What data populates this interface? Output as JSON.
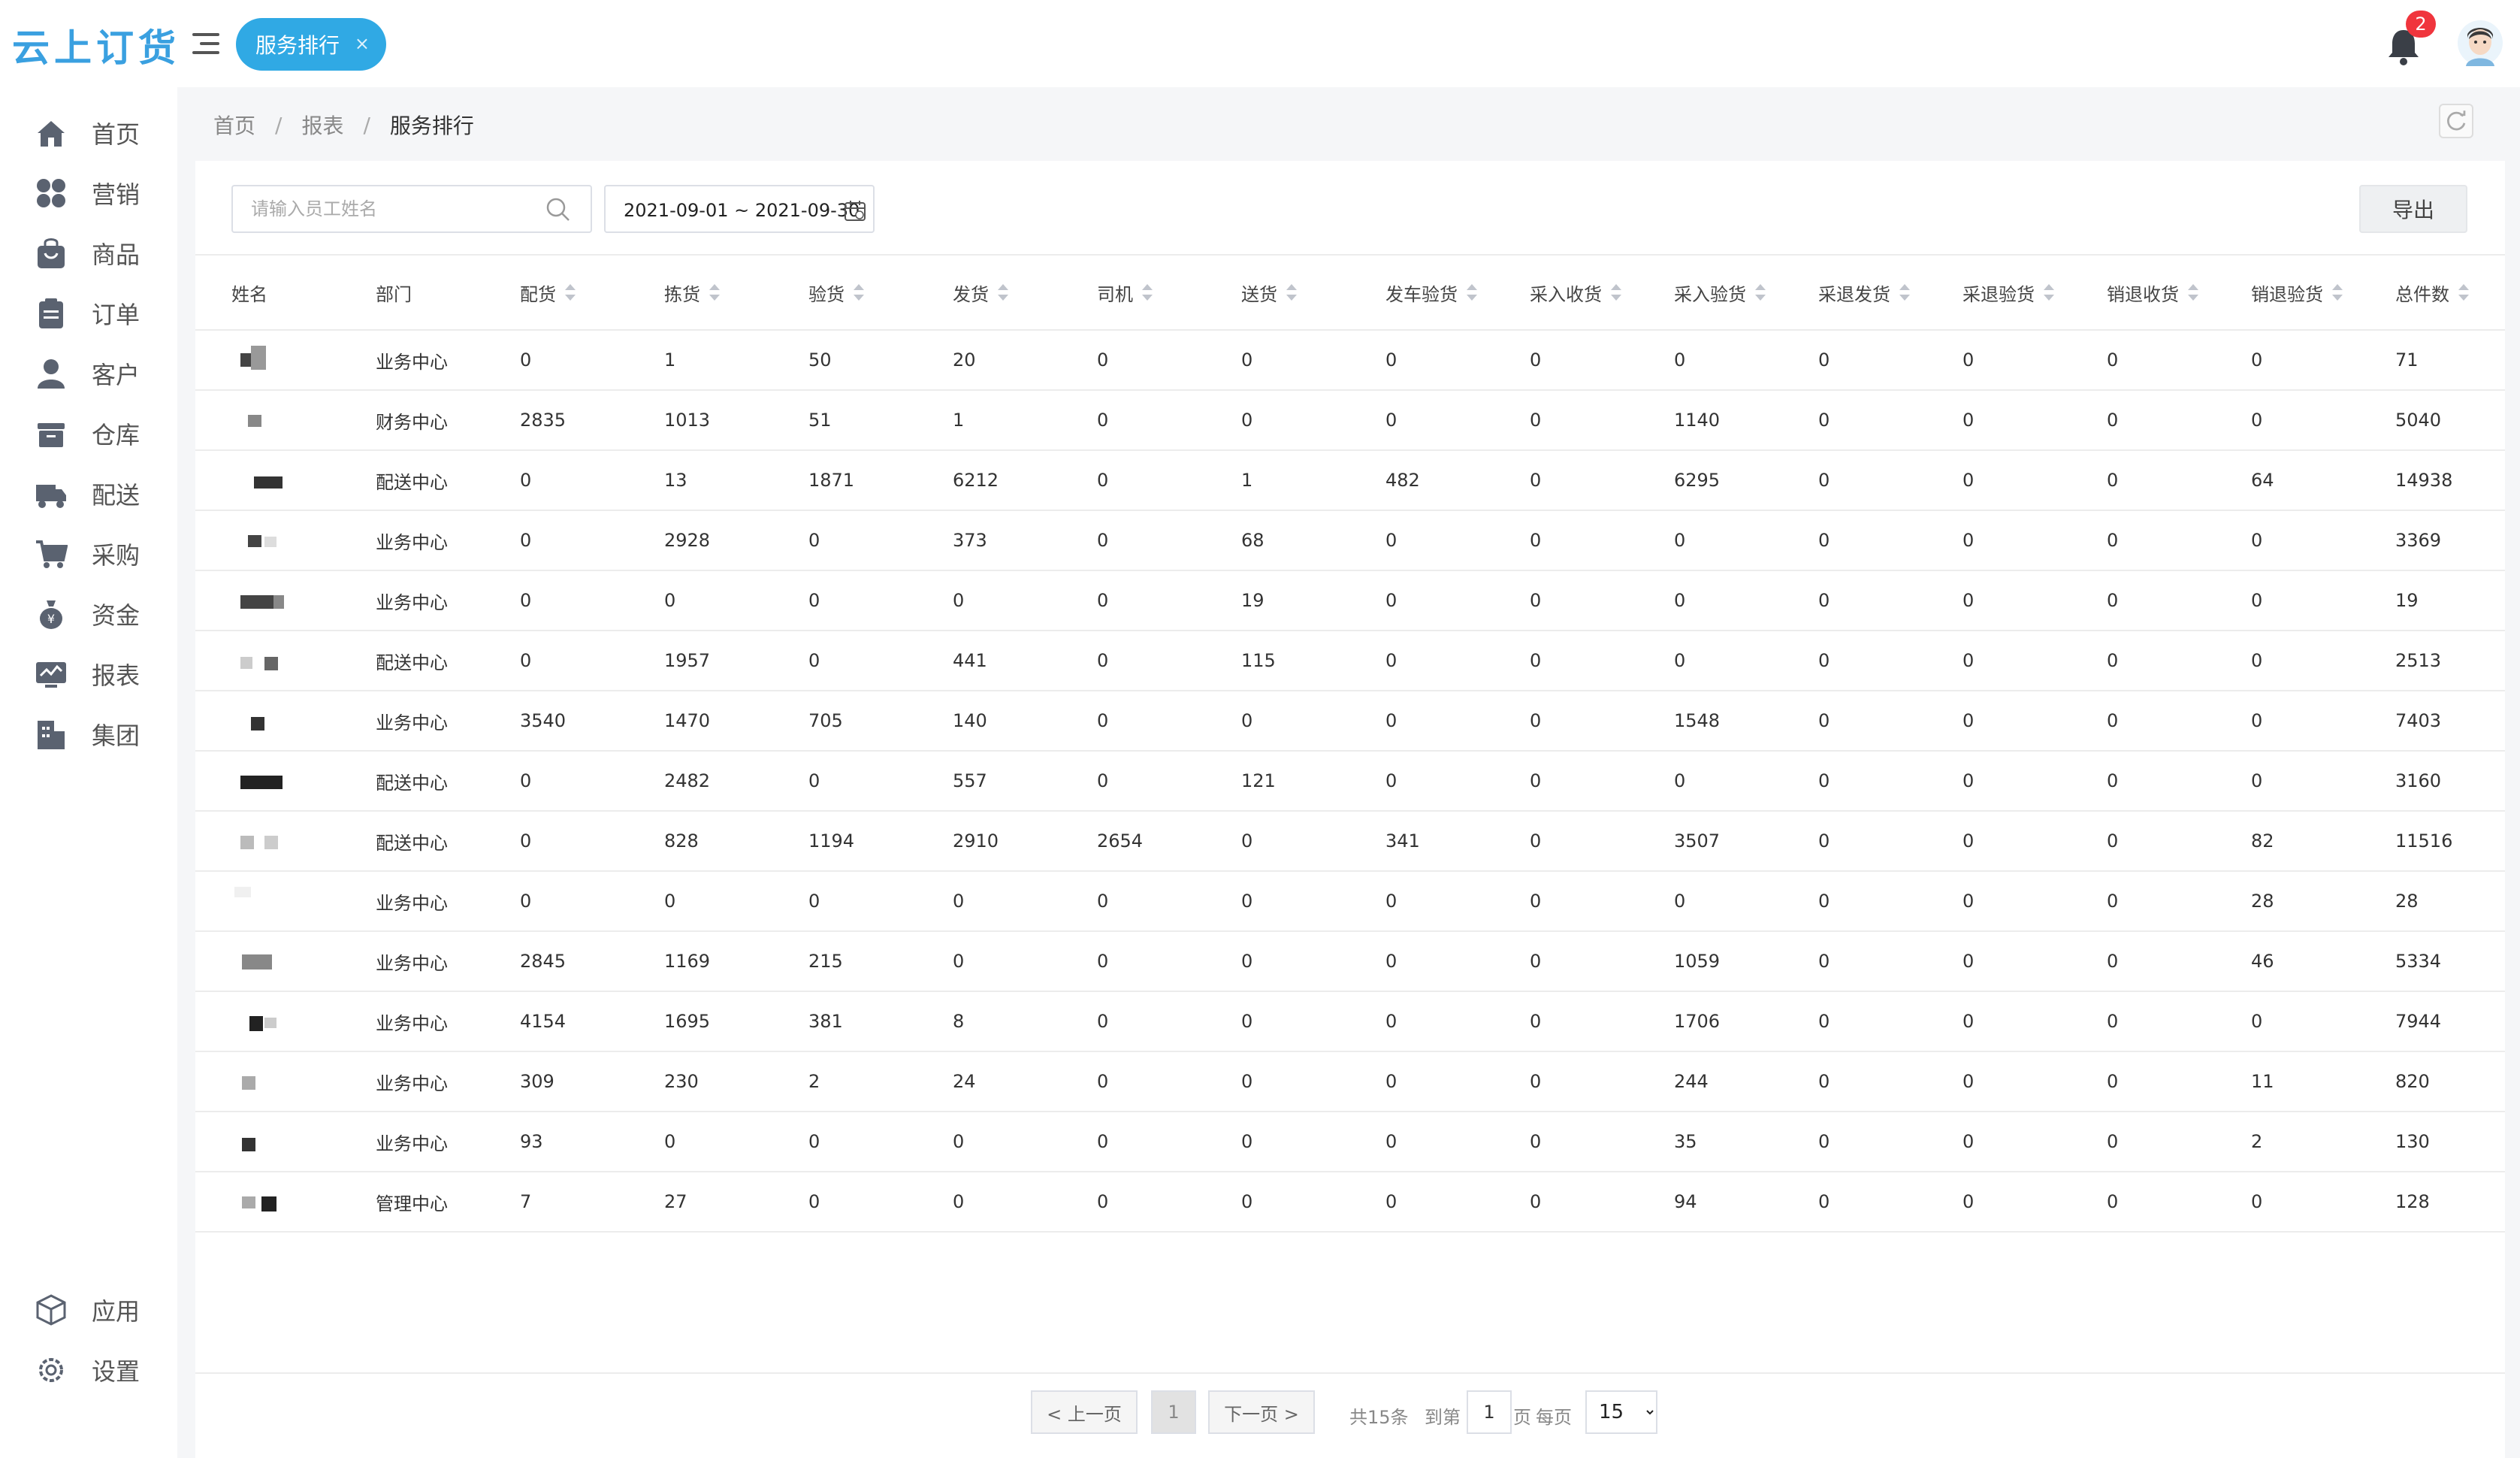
{
  "app": {
    "logo_text": "云上订货"
  },
  "header": {
    "active_tab": "服务排行",
    "tab_close": "×",
    "notification_count": "2"
  },
  "colors": {
    "accent": "#30a9e4",
    "badge": "#f0353d",
    "sidebar_icon": "#5a6270"
  },
  "sidebar": {
    "items": [
      {
        "label": "首页",
        "icon": "home-icon"
      },
      {
        "label": "营销",
        "icon": "grid-icon"
      },
      {
        "label": "商品",
        "icon": "bag-icon"
      },
      {
        "label": "订单",
        "icon": "clipboard-icon"
      },
      {
        "label": "客户",
        "icon": "person-icon"
      },
      {
        "label": "仓库",
        "icon": "warehouse-icon"
      },
      {
        "label": "配送",
        "icon": "truck-icon"
      },
      {
        "label": "采购",
        "icon": "cart-icon"
      },
      {
        "label": "资金",
        "icon": "money-bag-icon"
      },
      {
        "label": "报表",
        "icon": "monitor-chart-icon"
      },
      {
        "label": "集团",
        "icon": "building-icon"
      }
    ],
    "bottom_items": [
      {
        "label": "应用",
        "icon": "cube-icon"
      },
      {
        "label": "设置",
        "icon": "gear-icon"
      }
    ]
  },
  "breadcrumb": {
    "items": [
      "首页",
      "报表"
    ],
    "separator": "/",
    "current": "服务排行"
  },
  "filters": {
    "search_placeholder": "请输入员工姓名",
    "date_range": "2021-09-01 ~ 2021-09-30",
    "export_label": "导出"
  },
  "table": {
    "columns": [
      "姓名",
      "部门",
      "配货",
      "拣货",
      "验货",
      "发货",
      "司机",
      "送货",
      "发车验货",
      "采入收货",
      "采入验货",
      "采退发货",
      "采退验货",
      "销退收货",
      "销退验货",
      "总件数"
    ],
    "rows": [
      [
        "业务中心",
        "0",
        "1",
        "50",
        "20",
        "0",
        "0",
        "0",
        "0",
        "0",
        "0",
        "0",
        "0",
        "0",
        "71"
      ],
      [
        "财务中心",
        "2835",
        "1013",
        "51",
        "1",
        "0",
        "0",
        "0",
        "0",
        "1140",
        "0",
        "0",
        "0",
        "0",
        "5040"
      ],
      [
        "配送中心",
        "0",
        "13",
        "1871",
        "6212",
        "0",
        "1",
        "482",
        "0",
        "6295",
        "0",
        "0",
        "0",
        "64",
        "14938"
      ],
      [
        "业务中心",
        "0",
        "2928",
        "0",
        "373",
        "0",
        "68",
        "0",
        "0",
        "0",
        "0",
        "0",
        "0",
        "0",
        "3369"
      ],
      [
        "业务中心",
        "0",
        "0",
        "0",
        "0",
        "0",
        "19",
        "0",
        "0",
        "0",
        "0",
        "0",
        "0",
        "0",
        "19"
      ],
      [
        "配送中心",
        "0",
        "1957",
        "0",
        "441",
        "0",
        "115",
        "0",
        "0",
        "0",
        "0",
        "0",
        "0",
        "0",
        "2513"
      ],
      [
        "业务中心",
        "3540",
        "1470",
        "705",
        "140",
        "0",
        "0",
        "0",
        "0",
        "1548",
        "0",
        "0",
        "0",
        "0",
        "7403"
      ],
      [
        "配送中心",
        "0",
        "2482",
        "0",
        "557",
        "0",
        "121",
        "0",
        "0",
        "0",
        "0",
        "0",
        "0",
        "0",
        "3160"
      ],
      [
        "配送中心",
        "0",
        "828",
        "1194",
        "2910",
        "2654",
        "0",
        "341",
        "0",
        "3507",
        "0",
        "0",
        "0",
        "82",
        "11516"
      ],
      [
        "业务中心",
        "0",
        "0",
        "0",
        "0",
        "0",
        "0",
        "0",
        "0",
        "0",
        "0",
        "0",
        "0",
        "28",
        "28"
      ],
      [
        "业务中心",
        "2845",
        "1169",
        "215",
        "0",
        "0",
        "0",
        "0",
        "0",
        "1059",
        "0",
        "0",
        "0",
        "46",
        "5334"
      ],
      [
        "业务中心",
        "4154",
        "1695",
        "381",
        "8",
        "0",
        "0",
        "0",
        "0",
        "1706",
        "0",
        "0",
        "0",
        "0",
        "7944"
      ],
      [
        "业务中心",
        "309",
        "230",
        "2",
        "24",
        "0",
        "0",
        "0",
        "0",
        "244",
        "0",
        "0",
        "0",
        "11",
        "820"
      ],
      [
        "业务中心",
        "93",
        "0",
        "0",
        "0",
        "0",
        "0",
        "0",
        "0",
        "35",
        "0",
        "0",
        "0",
        "2",
        "130"
      ],
      [
        "管理中心",
        "7",
        "27",
        "0",
        "0",
        "0",
        "0",
        "0",
        "0",
        "94",
        "0",
        "0",
        "0",
        "0",
        "128"
      ]
    ]
  },
  "pagination": {
    "prev": "< 上一页",
    "current_page": "1",
    "next": "下一页 >",
    "total": "共15条",
    "goto_label": "到第",
    "goto_value": "1",
    "page_unit": "页",
    "per_page_label": "每页",
    "page_size": "15",
    "page_size_options": [
      "15"
    ]
  }
}
